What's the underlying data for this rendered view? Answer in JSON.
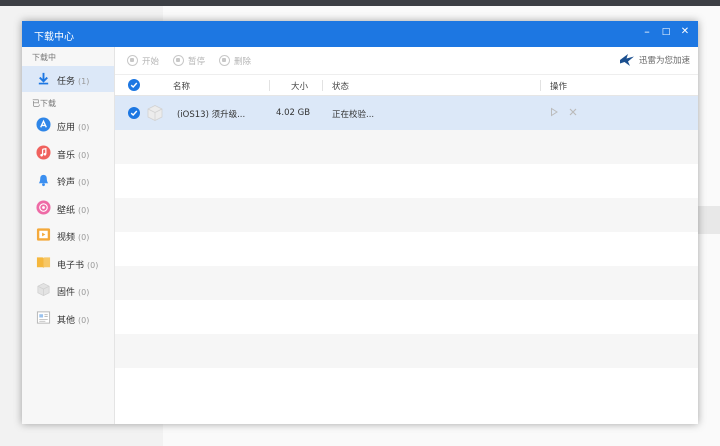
{
  "window": {
    "title": "下载中心",
    "minimize_label": "–",
    "maximize_label": "□",
    "close_label": "✕"
  },
  "sidebar": {
    "section_downloading": "下载中",
    "section_downloaded": "已下载",
    "items": [
      {
        "label": "任务",
        "count": "(1)",
        "icon": "download-arrow-icon"
      },
      {
        "label": "应用",
        "count": "(0)",
        "icon": "app-store-icon"
      },
      {
        "label": "音乐",
        "count": "(0)",
        "icon": "music-note-icon"
      },
      {
        "label": "铃声",
        "count": "(0)",
        "icon": "bell-icon"
      },
      {
        "label": "壁纸",
        "count": "(0)",
        "icon": "wallpaper-icon"
      },
      {
        "label": "视频",
        "count": "(0)",
        "icon": "video-icon"
      },
      {
        "label": "电子书",
        "count": "(0)",
        "icon": "ebook-icon"
      },
      {
        "label": "固件",
        "count": "(0)",
        "icon": "firmware-box-icon"
      },
      {
        "label": "其他",
        "count": "(0)",
        "icon": "other-file-icon"
      }
    ]
  },
  "toolbar": {
    "start_label": "开始",
    "pause_label": "暂停",
    "delete_label": "删除",
    "accelerate_label": "迅雷为您加速"
  },
  "table": {
    "columns": {
      "name": "名称",
      "size": "大小",
      "status": "状态",
      "action": "操作"
    },
    "rows": [
      {
        "name": "(iOS13) 须升级...",
        "size": "4.02 GB",
        "status": "正在校验..."
      }
    ]
  },
  "colors": {
    "accent": "#1d77e2",
    "selected_row": "#dce8f8"
  }
}
